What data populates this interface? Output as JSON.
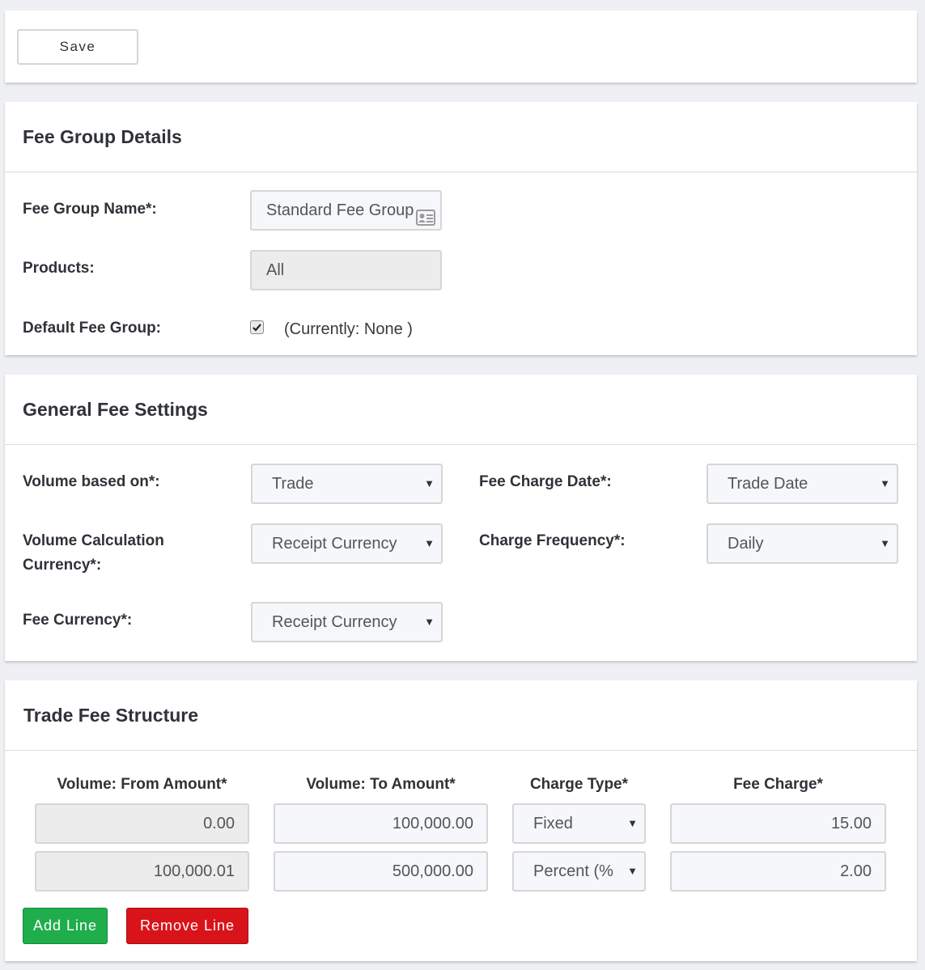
{
  "toolbar": {
    "save_label": "Save"
  },
  "fee_group_details": {
    "title": "Fee Group Details",
    "name_label": "Fee Group Name*:",
    "name_value": "Standard Fee Group",
    "products_label": "Products:",
    "products_value": "All",
    "default_label": "Default Fee Group:",
    "default_checked": true,
    "default_note": "(Currently: None )"
  },
  "general_fee_settings": {
    "title": "General Fee Settings",
    "volume_based_label": "Volume based on*:",
    "volume_based_value": "Trade",
    "fee_charge_date_label": "Fee Charge Date*:",
    "fee_charge_date_value": "Trade Date",
    "volume_calc_currency_label_1": "Volume Calculation",
    "volume_calc_currency_label_2": "Currency*:",
    "volume_calc_currency_value": "Receipt Currency",
    "charge_frequency_label": "Charge Frequency*:",
    "charge_frequency_value": "Daily",
    "fee_currency_label": "Fee Currency*:",
    "fee_currency_value": "Receipt Currency"
  },
  "trade_fee_structure": {
    "title": "Trade Fee Structure",
    "columns": [
      "Volume: From Amount*",
      "Volume: To Amount*",
      "Charge Type*",
      "Fee Charge*"
    ],
    "rows": [
      {
        "from": "0.00",
        "to": "100,000.00",
        "type": "Fixed",
        "charge": "15.00"
      },
      {
        "from": "100,000.01",
        "to": "500,000.00",
        "type": "Percent (%",
        "charge": "2.00"
      }
    ],
    "add_line_label": "Add Line",
    "remove_line_label": "Remove Line"
  },
  "colors": {
    "add_green": "#1fae4b",
    "remove_red": "#d9131a",
    "page_bg": "#eff0f3"
  },
  "icons": {
    "dropdown": "caret-down-icon",
    "name_field": "contact-card-icon",
    "checkbox": "checkbox-checked-icon"
  }
}
